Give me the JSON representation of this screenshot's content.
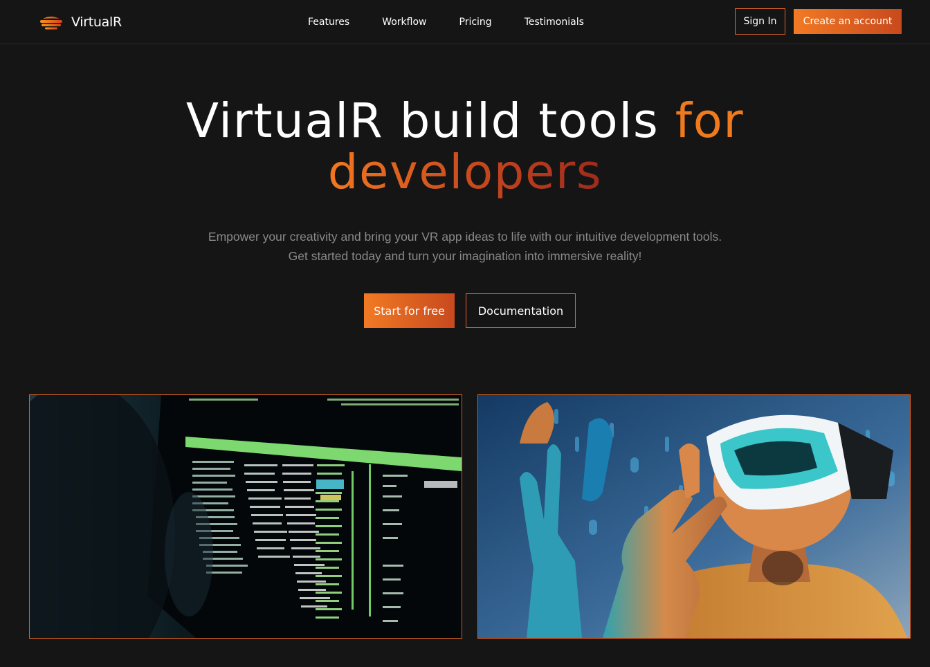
{
  "brand": {
    "name": "VirtualR",
    "logo_icon": "layers-logo-icon"
  },
  "nav": {
    "links": [
      "Features",
      "Workflow",
      "Pricing",
      "Testimonials"
    ],
    "sign_in": "Sign In",
    "create_account": "Create an account"
  },
  "hero": {
    "title_part1": "VirtualR build tools",
    "title_accent": "for",
    "title_line2": "developers",
    "subtitle_line1": "Empower your creativity and bring your VR app ideas to life with our intuitive development tools.",
    "subtitle_line2": "Get started today and turn your imagination into immersive reality!",
    "primary_cta": "Start for free",
    "secondary_cta": "Documentation"
  },
  "colors": {
    "background": "#161516",
    "accent": "#f27a24",
    "accent_dark": "#c8491d",
    "border": "#e2672a"
  },
  "images": {
    "left": {
      "icon": "code-terminal-image"
    },
    "right": {
      "icon": "vr-headset-person-image"
    }
  }
}
